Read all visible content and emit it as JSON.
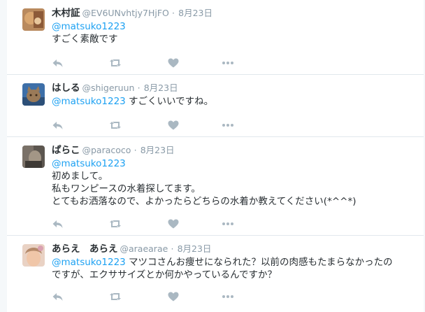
{
  "tweets": [
    {
      "name": "木村証",
      "screen_name": "@EV6UNvhtjy7HjFO",
      "dot": "·",
      "time": "8月23日",
      "mention": "@matsuko1223",
      "lines": [
        "すごく素敵です"
      ]
    },
    {
      "name": "はしる",
      "screen_name": "@shigeruun",
      "dot": "·",
      "time": "8月23日",
      "mention": "@matsuko1223",
      "lines": [
        " すごくいいですね。"
      ]
    },
    {
      "name": "ぱらこ",
      "screen_name": "@paracoco",
      "dot": "·",
      "time": "8月23日",
      "mention": "@matsuko1223",
      "lines": [
        "初めまして。",
        "私もワンピースの水着探してます。",
        "とてもお洒落なので、よかったらどちらの水着か教えてください(*^^*)"
      ]
    },
    {
      "name": "あらえ　あらえ",
      "screen_name": "@araearae",
      "dot": "·",
      "time": "8月23日",
      "mention": "@matsuko1223",
      "lines": [
        " マツコさんお痩せになられた？以前の肉感もたまらなかったの",
        "ですが、エクササイズとか何かやっているんですか？"
      ]
    }
  ],
  "icons": {
    "reply": "reply-icon",
    "retweet": "retweet-icon",
    "like": "heart-icon",
    "more": "more-icon"
  },
  "colors": {
    "link": "#1da1f2",
    "secondary": "#8899a6",
    "icon": "#aab8c2",
    "background": "#f5f8fa"
  }
}
